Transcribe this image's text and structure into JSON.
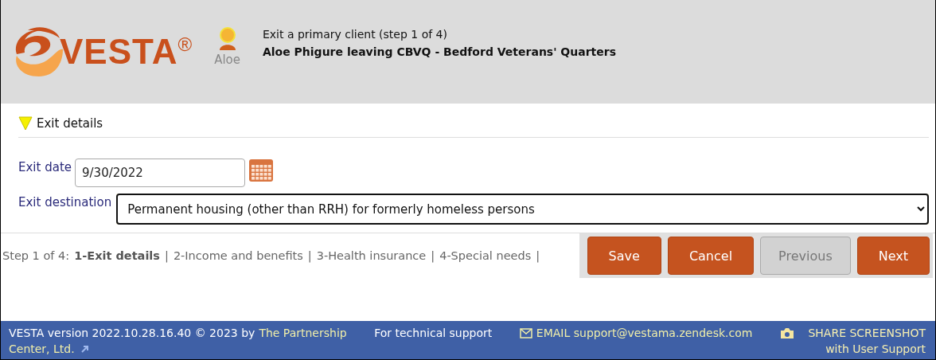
{
  "header": {
    "logo": {
      "text": "VESTA",
      "mark": "®"
    },
    "client": {
      "name": "Aloe"
    },
    "title": "Exit a primary client (step 1 of 4)",
    "subtitle": "Aloe Phigure leaving CBVQ - Bedford Veterans' Quarters"
  },
  "section": {
    "title": "Exit details",
    "expanded": true
  },
  "fields": [
    {
      "kind": "date",
      "label": "Exit date",
      "value": "9/30/2022"
    },
    {
      "kind": "select",
      "label": "Exit destination",
      "value": "Permanent housing (other than RRH) for formerly homeless persons"
    }
  ],
  "steps": {
    "prefix": "Step 1 of 4:",
    "separator": "|",
    "items": [
      {
        "label": "1-Exit details",
        "selected": true
      },
      {
        "label": "2-Income and benefits",
        "selected": false
      },
      {
        "label": "3-Health insurance",
        "selected": false
      },
      {
        "label": "4-Special needs",
        "selected": false
      }
    ]
  },
  "buttons": [
    {
      "label": "Save",
      "disabled": false
    },
    {
      "label": "Cancel",
      "disabled": false
    },
    {
      "label": "Previous",
      "disabled": true
    },
    {
      "label": "Next",
      "disabled": false
    }
  ],
  "footer": {
    "version": "VESTA version 2022.10.28.16.40 © 2023 by",
    "link": [
      "The Partnership",
      "Center, Ltd."
    ],
    "support": "For technical support",
    "email": "EMAIL support@vestama.zendesk.com",
    "share": "SHARE SCREENSHOT with User Support"
  }
}
